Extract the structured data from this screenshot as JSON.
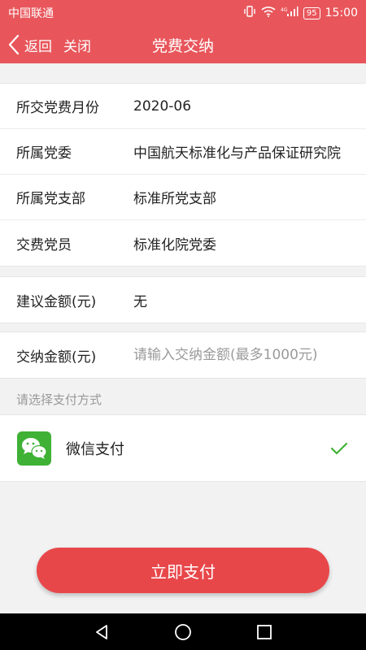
{
  "status_bar": {
    "carrier": "中国联通",
    "battery": "95",
    "time": "15:00",
    "network": "4G"
  },
  "nav": {
    "back_label": "返回",
    "close_label": "关闭",
    "title": "党费交纳"
  },
  "info_rows": [
    {
      "label": "所交党费月份",
      "value": "2020-06"
    },
    {
      "label": "所属党委",
      "value": "中国航天标准化与产品保证研究院"
    },
    {
      "label": "所属党支部",
      "value": "标准所党支部"
    },
    {
      "label": "交费党员",
      "value": "标准化院党委"
    }
  ],
  "suggested": {
    "label": "建议金额(元)",
    "value": "无"
  },
  "amount": {
    "label": "交纳金额(元)",
    "placeholder": "请输入交纳金额(最多1000元)",
    "value": ""
  },
  "payment": {
    "hint": "请选择支付方式",
    "method_label": "微信支付",
    "selected": true,
    "icon": "wechat-icon",
    "accent_color": "#3fb135"
  },
  "pay_button_label": "立即支付",
  "colors": {
    "header": "#e8565b",
    "pay_button": "#e8474a"
  }
}
